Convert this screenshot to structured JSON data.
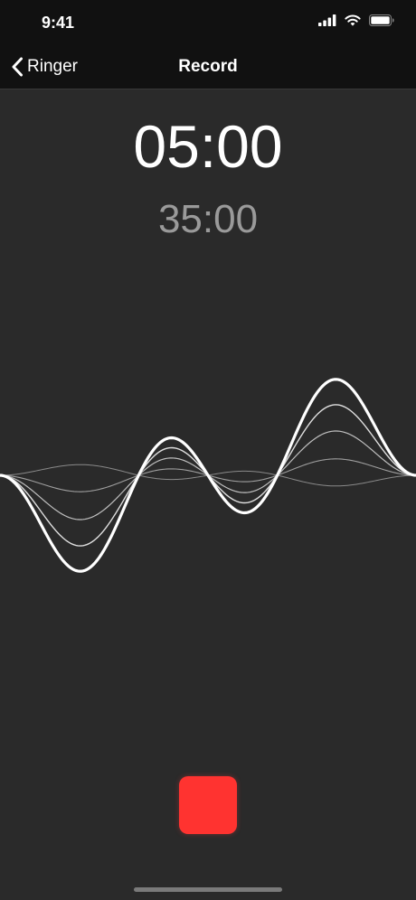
{
  "status_bar": {
    "time": "9:41",
    "icons": [
      "cellular-signal-icon",
      "wifi-icon",
      "battery-icon"
    ]
  },
  "nav": {
    "back_label": "Ringer",
    "back_icon": "chevron-left-icon",
    "title": "Record"
  },
  "timers": {
    "primary": "05:00",
    "secondary": "35:00"
  },
  "controls": {
    "stop_icon": "stop-icon",
    "stop_color": "#ff3330"
  },
  "colors": {
    "background": "#2a2a2a",
    "bars": "#111111",
    "secondary_text": "#9a9a9a"
  }
}
